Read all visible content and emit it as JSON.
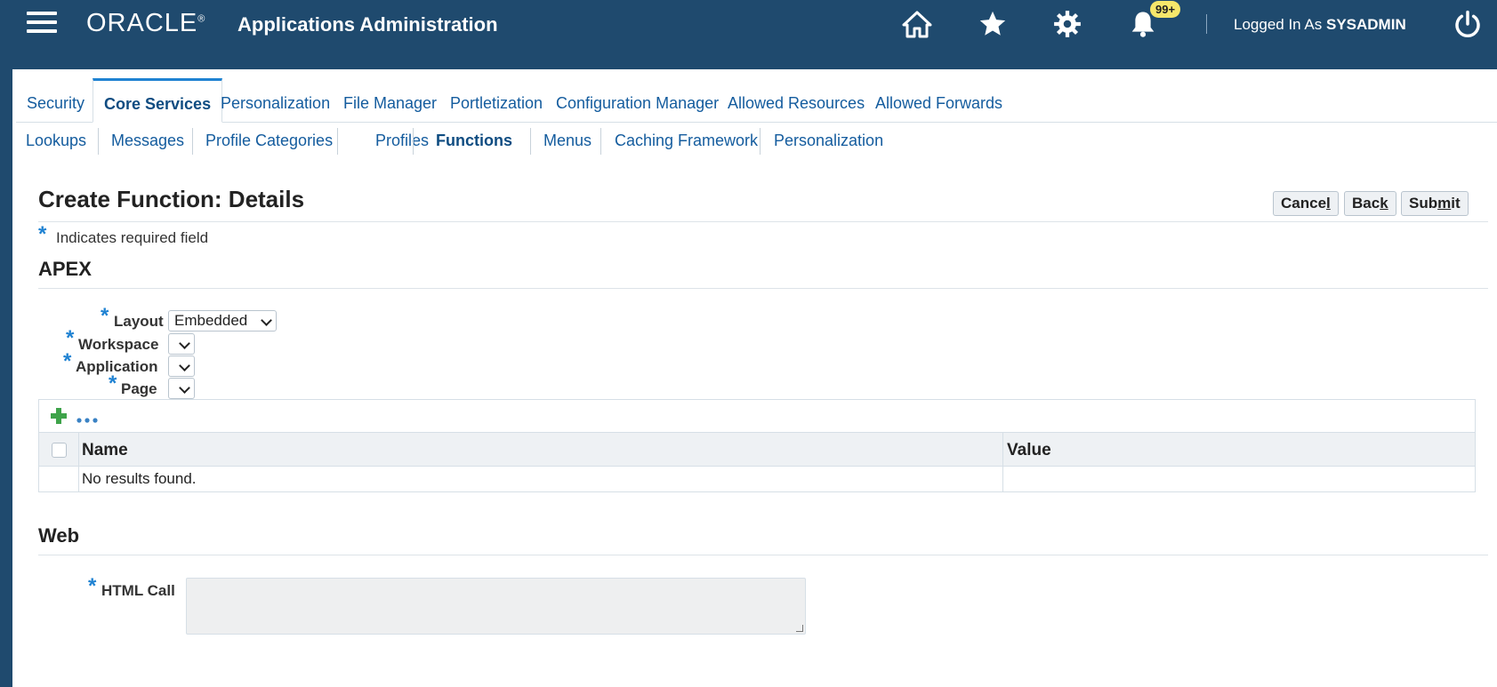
{
  "header": {
    "logo_text": "ORACLE",
    "logo_mark": "®",
    "app_title": "Applications Administration",
    "notification_badge": "99+",
    "logged_in_prefix": "Logged In As ",
    "user": "SYSADMIN",
    "icons": [
      "home-icon",
      "favorites-star-icon",
      "settings-gear-icon",
      "notifications-bell-icon",
      "logout-power-icon"
    ]
  },
  "tabs": [
    {
      "label": "Security",
      "active": false
    },
    {
      "label": "Core Services",
      "active": true
    },
    {
      "label": "Personalization",
      "active": false
    },
    {
      "label": "File Manager",
      "active": false
    },
    {
      "label": "Portletization",
      "active": false
    },
    {
      "label": "Configuration Manager",
      "active": false
    },
    {
      "label": "Allowed Resources",
      "active": false
    },
    {
      "label": "Allowed Forwards",
      "active": false
    }
  ],
  "subtabs": [
    {
      "label": "Lookups",
      "active": false
    },
    {
      "label": "Messages",
      "active": false
    },
    {
      "label": "Profile Categories",
      "active": false
    },
    {
      "label": "Profiles",
      "active": false
    },
    {
      "label": "Functions",
      "active": true
    },
    {
      "label": "Menus",
      "active": false
    },
    {
      "label": "Caching Framework",
      "active": false
    },
    {
      "label": "Personalization",
      "active": false
    }
  ],
  "page": {
    "title": "Create Function: Details",
    "required_marker": "*",
    "required_note": "Indicates required field",
    "buttons": {
      "cancel_before": "Cance",
      "cancel_underlined": "l",
      "cancel_after": "",
      "back_before": "Bac",
      "back_underlined": "k",
      "back_after": "",
      "submit_before": "Sub",
      "submit_underlined": "m",
      "submit_after": "it"
    }
  },
  "apex": {
    "section_title": "APEX",
    "fields": {
      "layout_label": "Layout",
      "layout_value": "Embedded",
      "workspace_label": "Workspace",
      "workspace_value": "",
      "application_label": "Application",
      "application_value": "",
      "page_label": "Page",
      "page_value": ""
    },
    "table": {
      "columns": [
        "Name",
        "Value"
      ],
      "empty_message": "No results found.",
      "toolbar_icons": [
        "add-row-icon",
        "more-actions-icon"
      ]
    }
  },
  "web": {
    "section_title": "Web",
    "html_call_label": "HTML Call",
    "html_call_value": ""
  },
  "colors": {
    "header_bg": "#1f4a6e",
    "link": "#145c9e",
    "required_star": "#1f82d2",
    "badge": "#f6e76b"
  }
}
